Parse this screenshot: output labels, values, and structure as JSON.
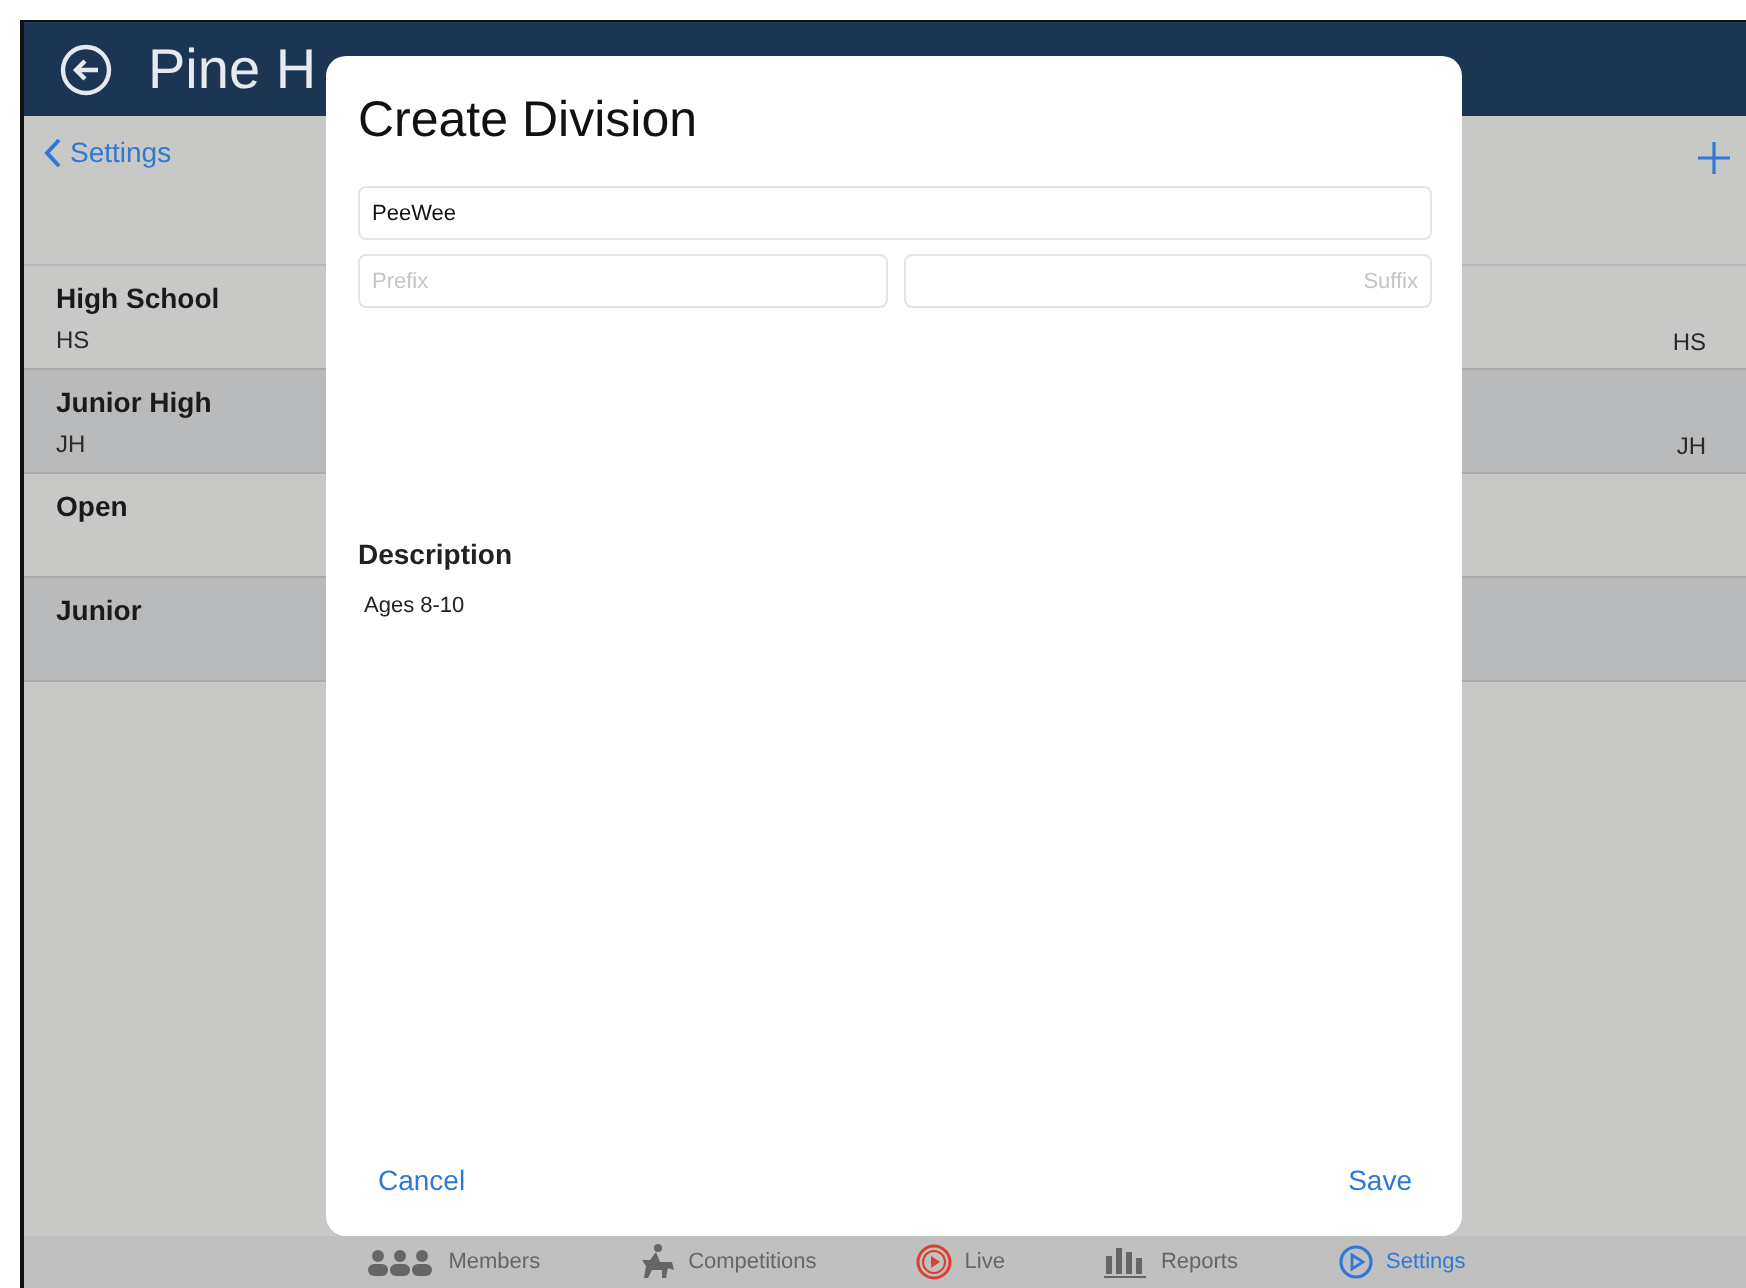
{
  "header": {
    "title": "Pine H"
  },
  "nav": {
    "back_label": "Settings"
  },
  "divisions": [
    {
      "name": "High School",
      "code": "HS",
      "trailing": "HS"
    },
    {
      "name": "Junior High",
      "code": "JH",
      "trailing": "JH"
    },
    {
      "name": "Open"
    },
    {
      "name": "Junior"
    }
  ],
  "dialog": {
    "title": "Create Division",
    "name_value": "PeeWee",
    "prefix_placeholder": "Prefix",
    "suffix_placeholder": "Suffix",
    "description_label": "Description",
    "description_value": "Ages 8-10",
    "cancel": "Cancel",
    "save": "Save"
  },
  "tab_bar": [
    {
      "label": "Members",
      "kind": "members",
      "selected": false
    },
    {
      "label": "Competitions",
      "kind": "competitions",
      "selected": false
    },
    {
      "label": "Live",
      "kind": "live",
      "selected": false
    },
    {
      "label": "Reports",
      "kind": "reports",
      "selected": false
    },
    {
      "label": "Settings",
      "kind": "settings",
      "selected": true
    }
  ]
}
